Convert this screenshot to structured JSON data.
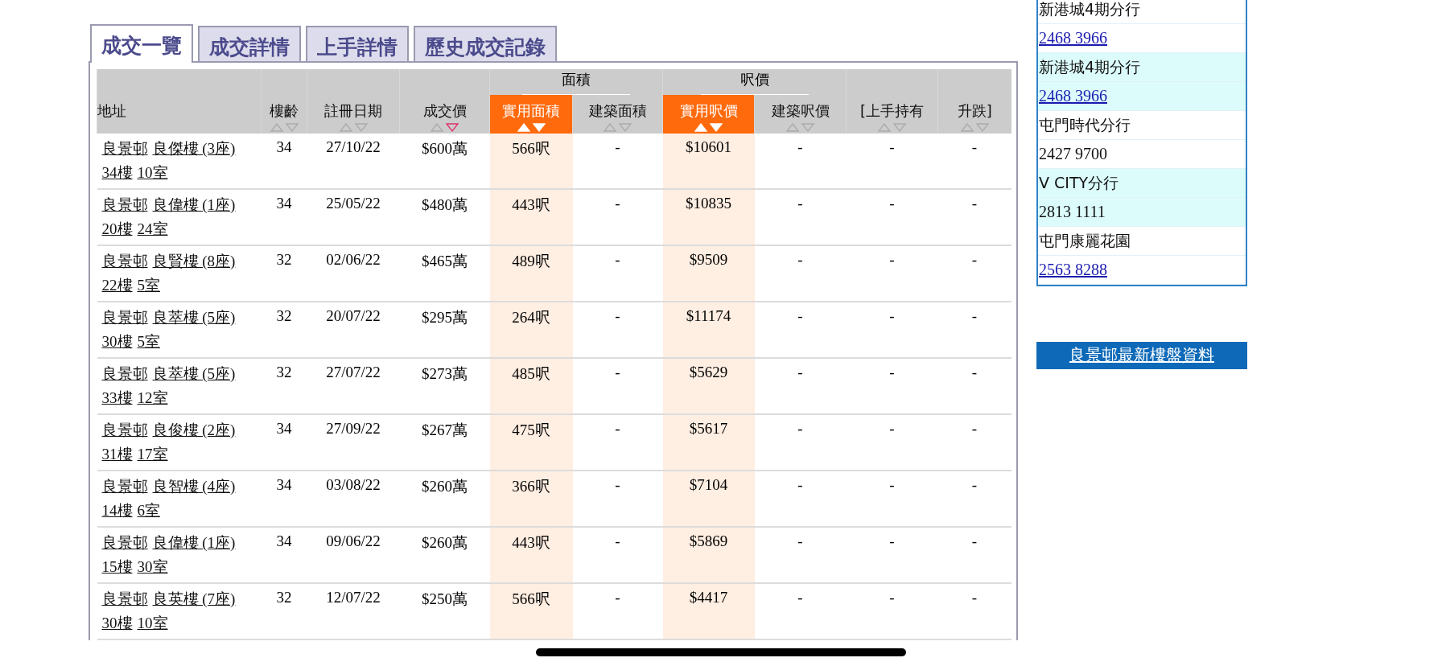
{
  "tabs": [
    {
      "label": "成交一覽",
      "selected": true
    },
    {
      "label": "成交詳情",
      "selected": false
    },
    {
      "label": "上手詳情",
      "selected": false
    },
    {
      "label": "歷史成交記錄",
      "selected": false
    }
  ],
  "table": {
    "groups": [
      {
        "label": "面積"
      },
      {
        "label": "呎價"
      }
    ],
    "columns": [
      {
        "label": "地址",
        "highlighted": false
      },
      {
        "label": "樓齡",
        "highlighted": false,
        "sorted_desc": false
      },
      {
        "label": "註冊日期",
        "highlighted": false,
        "sorted_desc": false
      },
      {
        "label": "成交價",
        "highlighted": false,
        "sorted_desc": true
      },
      {
        "label": "實用面積",
        "highlighted": true,
        "sorted_desc": false
      },
      {
        "label": "建築面積",
        "highlighted": false,
        "sorted_desc": false
      },
      {
        "label": "實用呎價",
        "highlighted": true,
        "sorted_desc": false
      },
      {
        "label": "建築呎價",
        "highlighted": false,
        "sorted_desc": false
      },
      {
        "label": "[上手持有",
        "highlighted": false,
        "sorted_desc": false
      },
      {
        "label": "升跌]",
        "highlighted": false,
        "sorted_desc": false
      }
    ],
    "rows": [
      {
        "cells": [
          [
            "良景邨",
            "良傑樓 (3座)",
            "34樓",
            "10室"
          ],
          "34",
          "27/10/22",
          "$600萬",
          "566呎",
          "-",
          "$10601",
          "-",
          "-",
          "-"
        ]
      },
      {
        "cells": [
          [
            "良景邨",
            "良偉樓 (1座)",
            "20樓",
            "24室"
          ],
          "34",
          "25/05/22",
          "$480萬",
          "443呎",
          "-",
          "$10835",
          "-",
          "-",
          "-"
        ]
      },
      {
        "cells": [
          [
            "良景邨",
            "良賢樓 (8座)",
            "22樓",
            "5室"
          ],
          "32",
          "02/06/22",
          "$465萬",
          "489呎",
          "-",
          "$9509",
          "-",
          "-",
          "-"
        ]
      },
      {
        "cells": [
          [
            "良景邨",
            "良萃樓 (5座)",
            "30樓",
            "5室"
          ],
          "32",
          "20/07/22",
          "$295萬",
          "264呎",
          "-",
          "$11174",
          "-",
          "-",
          "-"
        ]
      },
      {
        "cells": [
          [
            "良景邨",
            "良萃樓 (5座)",
            "33樓",
            "12室"
          ],
          "32",
          "27/07/22",
          "$273萬",
          "485呎",
          "-",
          "$5629",
          "-",
          "-",
          "-"
        ]
      },
      {
        "cells": [
          [
            "良景邨",
            "良俊樓 (2座)",
            "31樓",
            "17室"
          ],
          "34",
          "27/09/22",
          "$267萬",
          "475呎",
          "-",
          "$5617",
          "-",
          "-",
          "-"
        ]
      },
      {
        "cells": [
          [
            "良景邨",
            "良智樓 (4座)",
            "14樓",
            "6室"
          ],
          "34",
          "03/08/22",
          "$260萬",
          "366呎",
          "-",
          "$7104",
          "-",
          "-",
          "-"
        ]
      },
      {
        "cells": [
          [
            "良景邨",
            "良偉樓 (1座)",
            "15樓",
            "30室"
          ],
          "34",
          "09/06/22",
          "$260萬",
          "443呎",
          "-",
          "$5869",
          "-",
          "-",
          "-"
        ]
      },
      {
        "cells": [
          [
            "良景邨",
            "良英樓 (7座)",
            "30樓",
            "10室"
          ],
          "32",
          "12/07/22",
          "$250萬",
          "566呎",
          "-",
          "$4417",
          "-",
          "-",
          "-"
        ]
      }
    ]
  },
  "branches": [
    {
      "name": "新港城4期分行",
      "phone": "2468 3966",
      "link": true,
      "shaded": false
    },
    {
      "name": "新港城4期分行",
      "phone": "2468 3966",
      "link": true,
      "shaded": true
    },
    {
      "name": "屯門時代分行",
      "phone": "2427 9700",
      "link": false,
      "shaded": false
    },
    {
      "name": "V CITY分行",
      "phone": "2813 1111",
      "link": false,
      "shaded": true
    },
    {
      "name": "屯門康麗花園",
      "phone": "2563 8288",
      "link": true,
      "shaded": false
    }
  ],
  "latest_button": "良景邨最新樓盤資料"
}
